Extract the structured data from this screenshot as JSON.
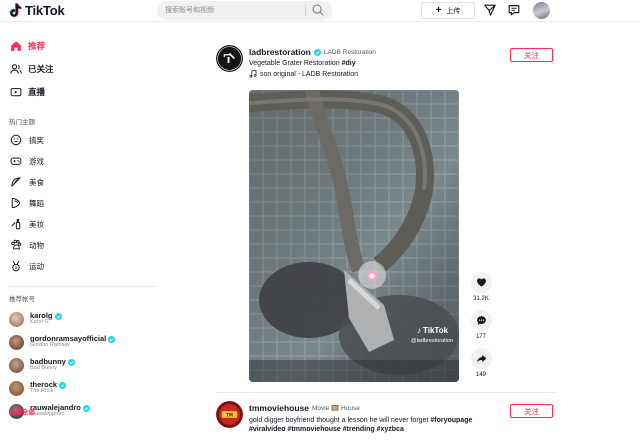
{
  "header": {
    "logo_text": "TikTok",
    "search_placeholder": "搜索账号和视频",
    "upload_label": "上传"
  },
  "sidebar": {
    "nav": [
      {
        "label": "推荐",
        "icon": "home-icon",
        "active": true
      },
      {
        "label": "已关注",
        "icon": "following-icon",
        "active": false
      },
      {
        "label": "直播",
        "icon": "live-icon",
        "active": false
      }
    ],
    "topics_title": "热门主题",
    "topics": [
      {
        "label": "搞笑",
        "icon": "comedy-icon"
      },
      {
        "label": "游戏",
        "icon": "gaming-icon"
      },
      {
        "label": "美食",
        "icon": "food-icon"
      },
      {
        "label": "舞蹈",
        "icon": "dance-icon"
      },
      {
        "label": "美妆",
        "icon": "beauty-icon"
      },
      {
        "label": "动物",
        "icon": "animals-icon"
      },
      {
        "label": "运动",
        "icon": "sports-icon"
      }
    ],
    "accounts_title": "推荐帐号",
    "accounts": [
      {
        "username": "karolg",
        "name": "Karol G",
        "color": "#c9a58a"
      },
      {
        "username": "gordonramsayofficial",
        "name": "Gordon Ramsay",
        "color": "#6b4a3a"
      },
      {
        "username": "badbunny",
        "name": "Bad Bunny",
        "color": "#8a6b5d"
      },
      {
        "username": "therock",
        "name": "The Rock",
        "color": "#a0785a"
      },
      {
        "username": "rauwalejandro",
        "name": "rauwalejandro",
        "color": "#3c3a3f"
      }
    ],
    "see_all": "查看全部"
  },
  "posts": [
    {
      "username": "ladbrestoration",
      "nickname": "LADB Restoration",
      "caption": "Vegetable Grater Restoration",
      "hashtag": "#diy",
      "music": "son original - LADB Restoration",
      "follow_label": "关注",
      "likes": "31.2K",
      "comments": "177",
      "shares": "149",
      "watermark": "TikTok",
      "watermark_user": "@ladbrestoration"
    },
    {
      "username": "tmmoviehouse",
      "nickname": "Movie 🎞️ House",
      "caption": "gold digger boyfriend thought a lesson he will never forget",
      "hashtags": "#foryoupage #viralvideo #tmmoviehouse #trending #xyzbca",
      "follow_label": "关注"
    }
  ],
  "colors": {
    "accent": "#fe2c55",
    "verified": "#20d5ec"
  }
}
